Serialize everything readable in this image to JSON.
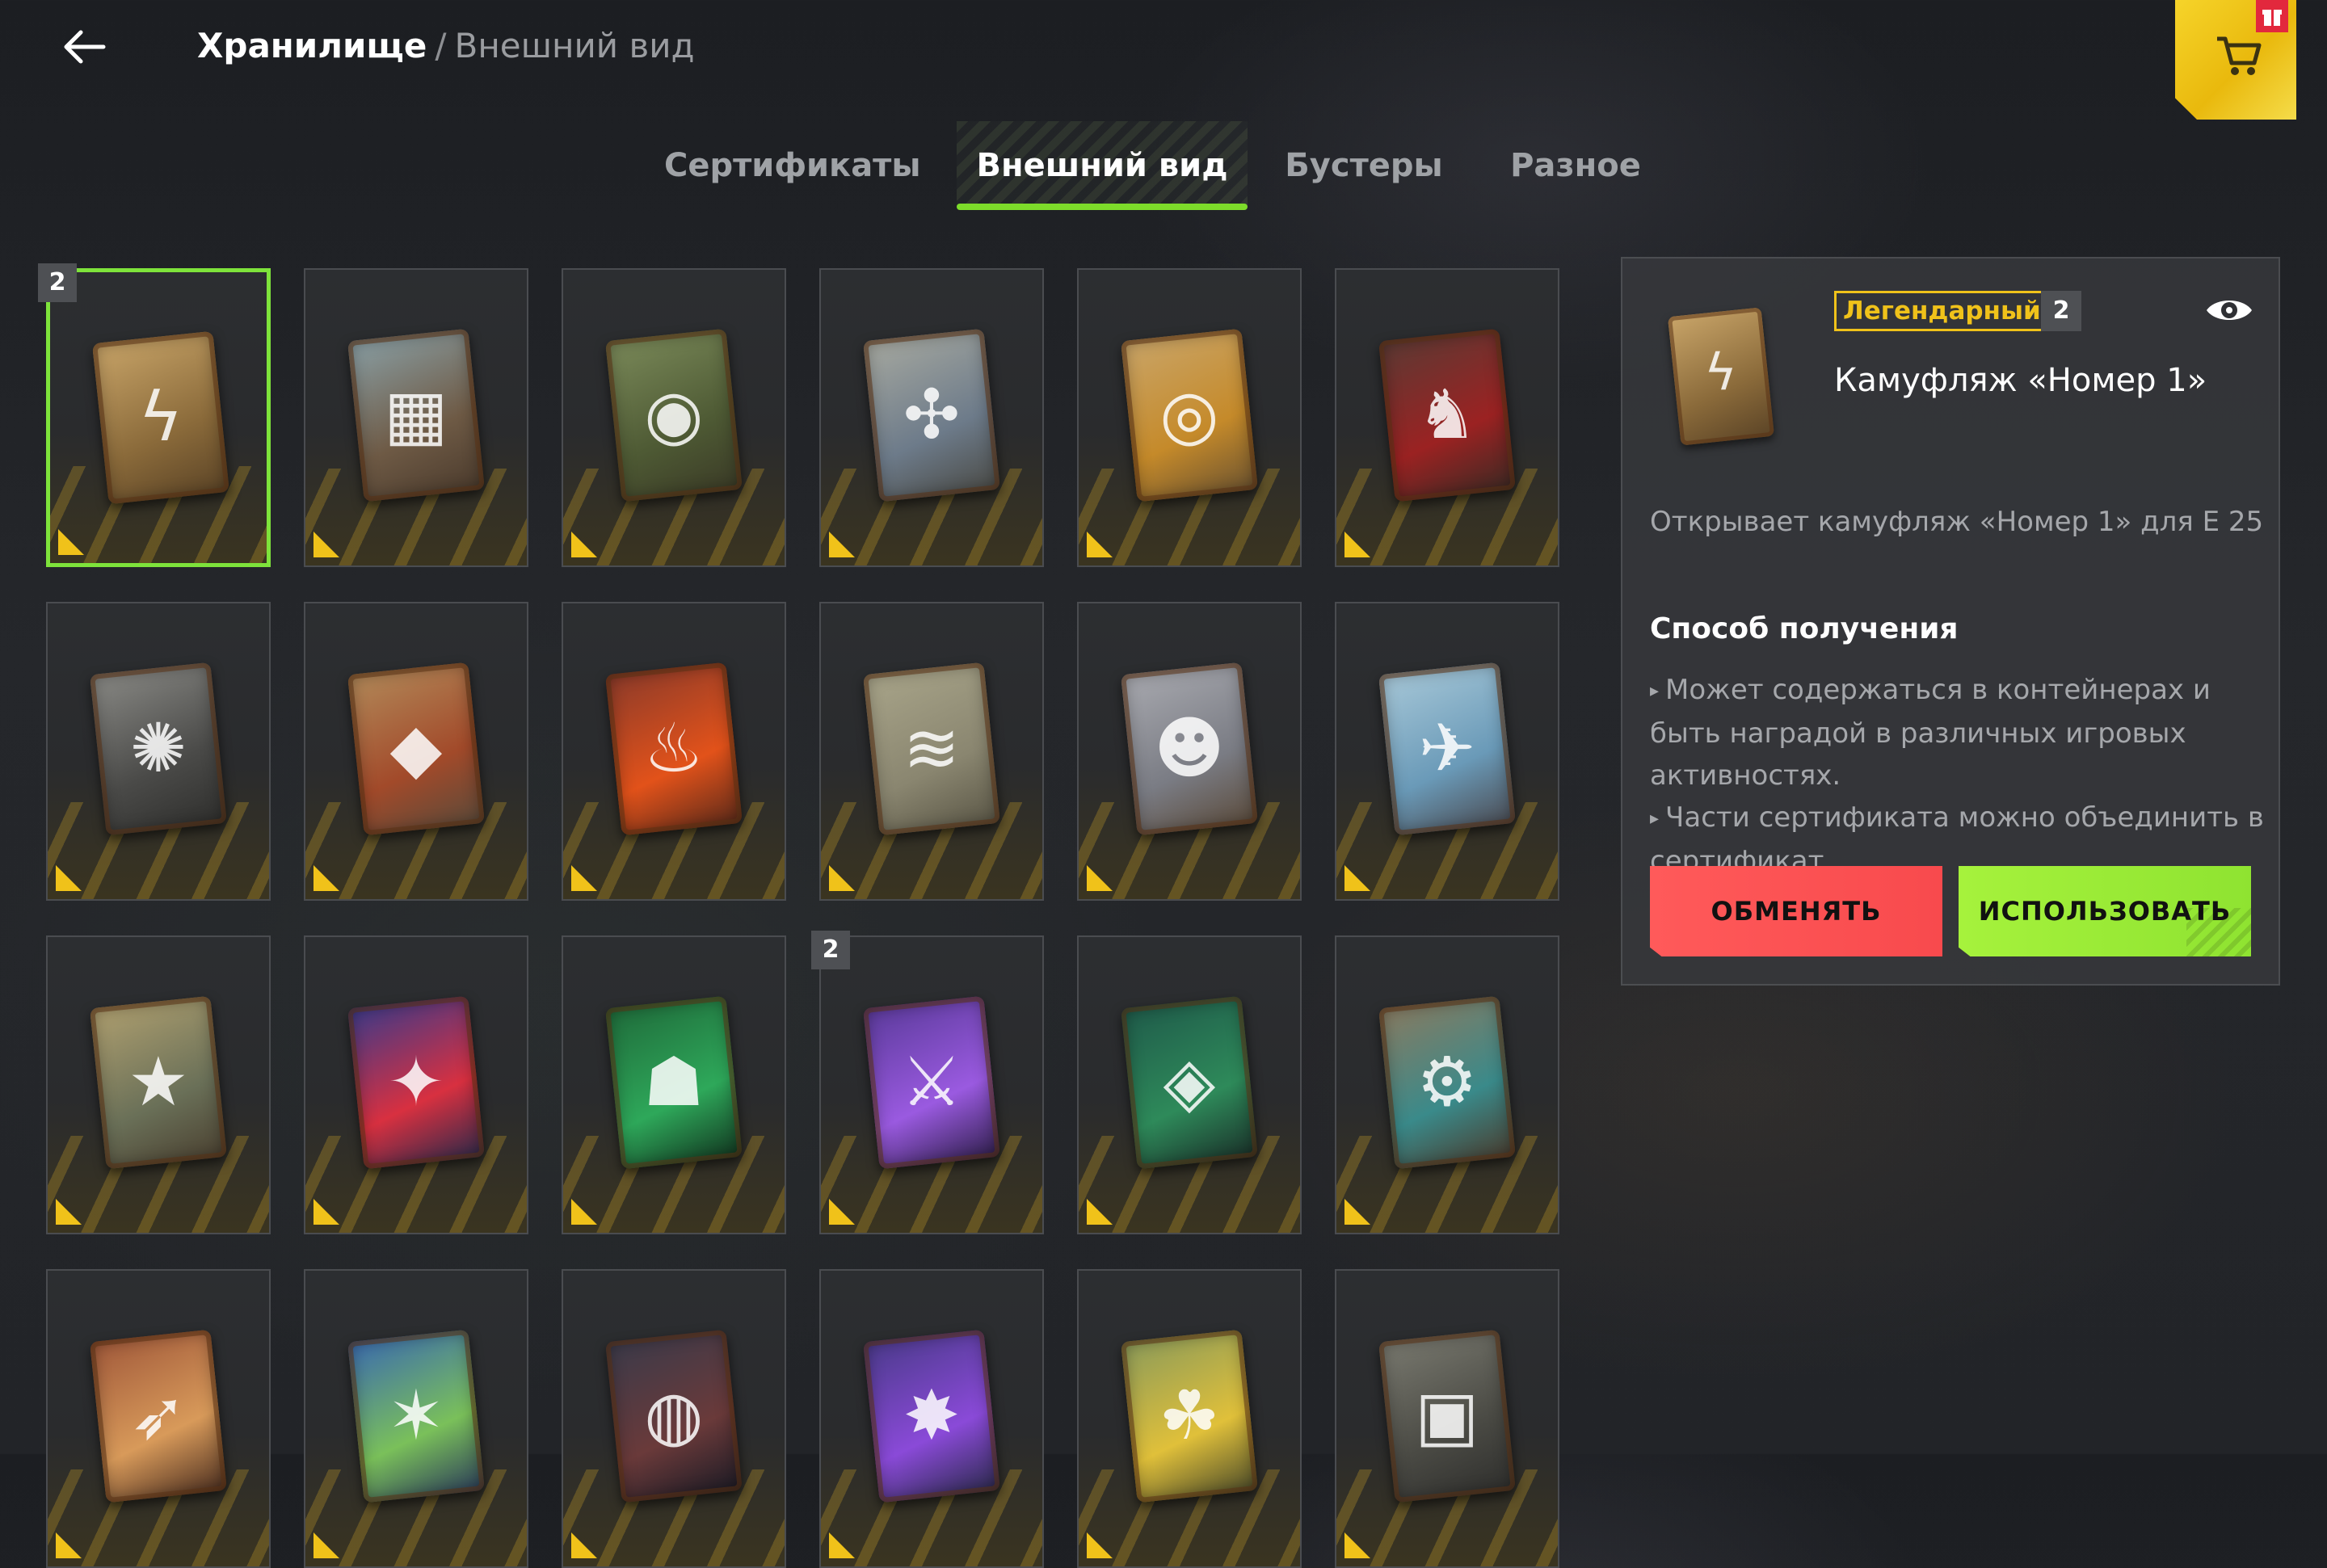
{
  "header": {
    "breadcrumb_root": "Хранилище",
    "breadcrumb_separator": "/",
    "breadcrumb_current": "Внешний вид"
  },
  "tabs": [
    {
      "label": "Сертификаты",
      "active": false
    },
    {
      "label": "Внешний вид",
      "active": true
    },
    {
      "label": "Бустеры",
      "active": false
    },
    {
      "label": "Разное",
      "active": false
    }
  ],
  "grid": {
    "items": [
      {
        "icon": "camo-emblem-card",
        "count": "2",
        "selected": true
      },
      {
        "icon": "blue-camo-card"
      },
      {
        "icon": "dragon-eye-card"
      },
      {
        "icon": "blue-cells-card"
      },
      {
        "icon": "gold-band-card"
      },
      {
        "icon": "red-wolf-card"
      },
      {
        "icon": "white-dragon-card"
      },
      {
        "icon": "shield-card"
      },
      {
        "icon": "fire-bottle-card"
      },
      {
        "icon": "claw-marks-card"
      },
      {
        "icon": "rabbit-card"
      },
      {
        "icon": "gun-robot-card"
      },
      {
        "icon": "star-crate-card"
      },
      {
        "icon": "police-light-card"
      },
      {
        "icon": "green-wanderer-card"
      },
      {
        "icon": "purple-sword-card",
        "count": "2"
      },
      {
        "icon": "green-cube-card"
      },
      {
        "icon": "retro-robot-card"
      },
      {
        "icon": "rocket-card"
      },
      {
        "icon": "christmas-tree-card"
      },
      {
        "icon": "black-hole-card"
      },
      {
        "icon": "purple-blaster-card"
      },
      {
        "icon": "duck-card"
      },
      {
        "icon": "gray-tank-card"
      }
    ]
  },
  "detail": {
    "rarity": "Легендарный",
    "count": "2",
    "title": "Камуфляж «Номер 1»",
    "description": "Открывает камуфляж «Номер 1» для Е 25",
    "obtain_heading": "Способ получения",
    "bullets": [
      "Может содержаться в контейнерах и быть наградой в различных игровых активностях.",
      "Части сертификата можно объединить в сертификат."
    ],
    "exchange_label": "ОБМЕНЯТЬ",
    "use_label": "ИСПОЛЬЗОВАТЬ"
  },
  "colors": {
    "accent_green": "#7ee33b",
    "rarity_gold": "#f0c21a",
    "exchange_red": "#f84a4d",
    "use_green": "#a6f23c"
  }
}
